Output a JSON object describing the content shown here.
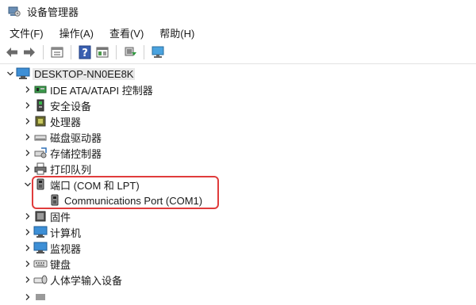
{
  "window": {
    "title": "设备管理器"
  },
  "menu": {
    "items": [
      {
        "label": "文件(F)"
      },
      {
        "label": "操作(A)"
      },
      {
        "label": "查看(V)"
      },
      {
        "label": "帮助(H)"
      }
    ]
  },
  "toolbar": {
    "buttons": [
      "back-arrow-icon",
      "forward-arrow-icon",
      "properties-icon",
      "help-icon",
      "show-hidden-icon",
      "update-driver-icon",
      "monitor-scan-icon"
    ]
  },
  "tree": {
    "root": {
      "label": "DESKTOP-NN0EE8K",
      "expanded": true
    },
    "categories": [
      {
        "label": "IDE ATA/ATAPI 控制器",
        "icon": "ide-controller-icon",
        "expanded": false
      },
      {
        "label": "安全设备",
        "icon": "security-device-icon",
        "expanded": false
      },
      {
        "label": "处理器",
        "icon": "processor-icon",
        "expanded": false
      },
      {
        "label": "磁盘驱动器",
        "icon": "disk-drive-icon",
        "expanded": false
      },
      {
        "label": "存储控制器",
        "icon": "storage-controller-icon",
        "expanded": false
      },
      {
        "label": "打印队列",
        "icon": "printer-icon",
        "expanded": false
      },
      {
        "label": "端口 (COM 和 LPT)",
        "icon": "port-icon",
        "expanded": true,
        "children": [
          {
            "label": "Communications Port (COM1)",
            "icon": "port-icon"
          }
        ]
      },
      {
        "label": "固件",
        "icon": "firmware-icon",
        "expanded": false
      },
      {
        "label": "计算机",
        "icon": "computer-icon",
        "expanded": false
      },
      {
        "label": "监视器",
        "icon": "monitor-icon",
        "expanded": false
      },
      {
        "label": "键盘",
        "icon": "keyboard-icon",
        "expanded": false
      },
      {
        "label": "人体学输入设备",
        "icon": "hid-icon",
        "expanded": false
      }
    ]
  },
  "colors": {
    "highlight_border": "#e03c3c"
  }
}
